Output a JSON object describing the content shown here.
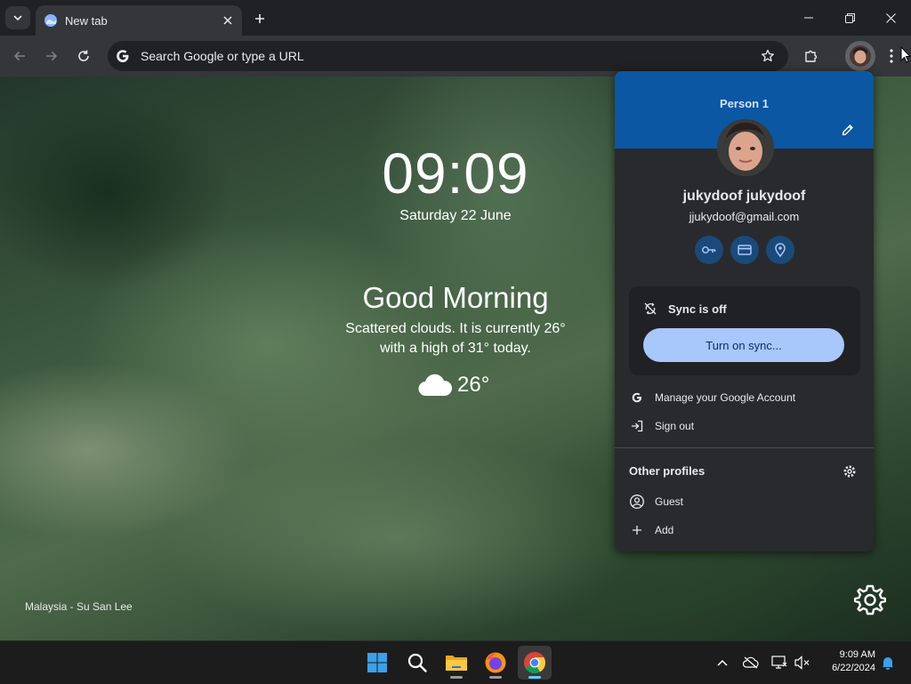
{
  "browser": {
    "tab_title": "New tab",
    "omnibox_placeholder": "Search Google or type a URL"
  },
  "ntp": {
    "time": "09:09",
    "date": "Saturday 22 June",
    "greeting": "Good Morning",
    "weather_line1": "Scattered clouds. It is currently 26°",
    "weather_line2": "with a high of 31° today.",
    "temperature": "26°",
    "photo_credit": "Malaysia - Su San Lee"
  },
  "profile_menu": {
    "profile_label": "Person 1",
    "name": "jukydoof jukydoof",
    "email": "jjukydoof@gmail.com",
    "quick_actions": [
      "key-icon",
      "credit-card-icon",
      "location-pin-icon"
    ],
    "sync_status": "Sync is off",
    "sync_button": "Turn on sync...",
    "manage_account": "Manage your Google Account",
    "sign_out": "Sign out",
    "other_profiles_title": "Other profiles",
    "guest": "Guest",
    "add": "Add"
  },
  "taskbar": {
    "time": "9:09 AM",
    "date": "6/22/2024"
  },
  "colors": {
    "menu_header": "#0b57a3",
    "sync_button": "#a8c7fa",
    "taskbar_active": "#60cdff"
  }
}
